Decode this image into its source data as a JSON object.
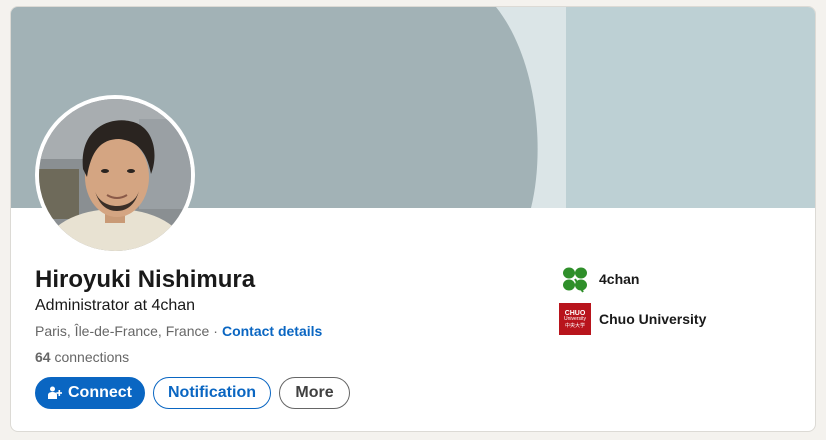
{
  "profile": {
    "name": "Hiroyuki Nishimura",
    "headline": "Administrator at 4chan",
    "location": "Paris, Île-de-France, France",
    "separator": "·",
    "contact_link": "Contact details",
    "connections_count": "64",
    "connections_label": "connections"
  },
  "actions": {
    "connect_label": "Connect",
    "notification_label": "Notification",
    "more_label": "More"
  },
  "organizations": [
    {
      "name": "4chan",
      "icon": "clover-icon",
      "color": "#2f8f2a"
    },
    {
      "name": "Chuo University",
      "icon": "chuo-university-logo",
      "color": "#b8141c",
      "logo_lines": [
        "CHUO",
        "University",
        "中央大学"
      ]
    }
  ],
  "colors": {
    "accent": "#0a66c2",
    "cover_dark": "#a2b2b6",
    "cover_light": "#dbe5e7",
    "cover_mid": "#bdd0d4"
  }
}
